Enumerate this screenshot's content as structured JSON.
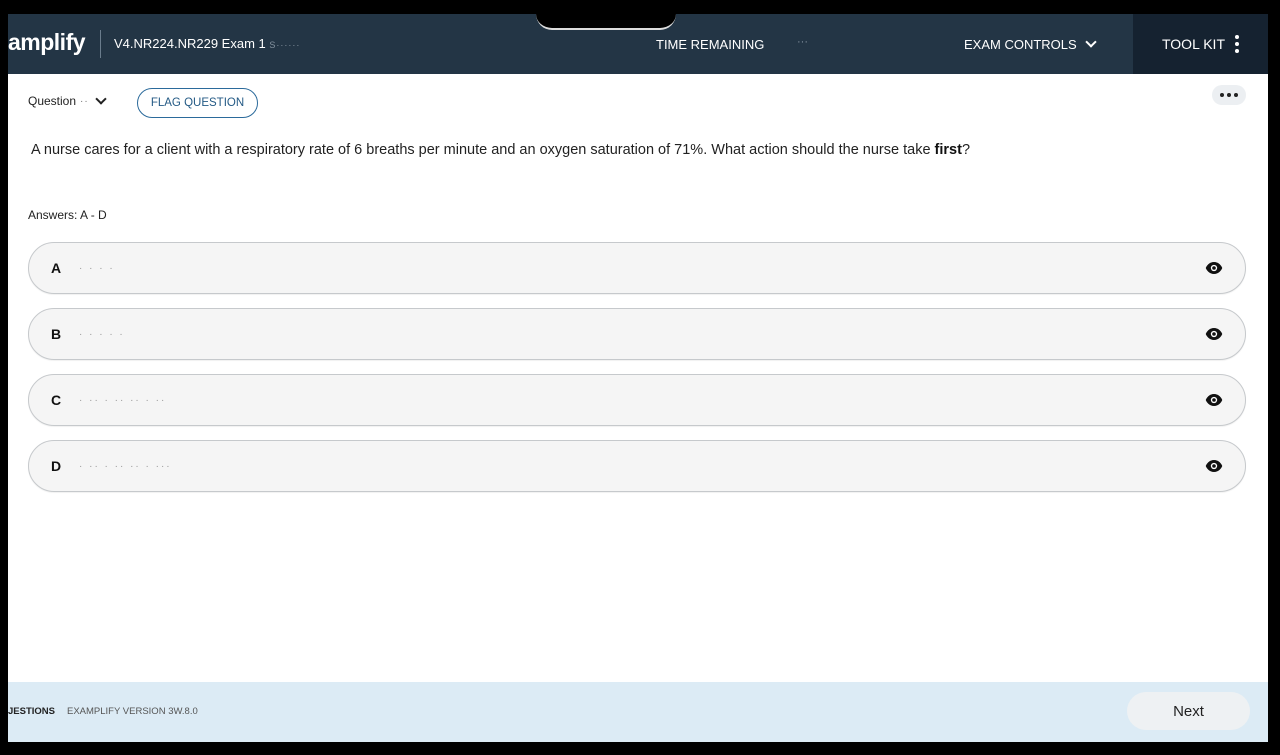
{
  "header": {
    "brand": "amplify",
    "exam_title": "V4.NR224.NR229 Exam 1",
    "exam_title_suffix": "S······",
    "time_label": "TIME REMAINING",
    "time_value": "···",
    "exam_controls_label": "EXAM CONTROLS",
    "toolkit_label": "TOOL KIT"
  },
  "question": {
    "selector_label": "Question",
    "selector_number": "··",
    "flag_label": "FLAG QUESTION",
    "stem_prefix": "A nurse cares for a client with a respiratory rate of 6 breaths per minute and an oxygen saturation of 71%. What action should the nurse take ",
    "stem_bold": "first",
    "stem_suffix": "?",
    "answers_label": "Answers: A - D"
  },
  "options": [
    {
      "letter": "A",
      "text": "·   ·   · ·"
    },
    {
      "letter": "B",
      "text": "·   · · · ·"
    },
    {
      "letter": "C",
      "text": "· ·· · ·· ·· ·  ··"
    },
    {
      "letter": "D",
      "text": "· ·· · ·· ·· · ···"
    }
  ],
  "footer": {
    "questions_label": "JESTIONS",
    "version_label": "EXAMPLIFY VERSION 3W.8.0",
    "next_label": "Next"
  },
  "colors": {
    "header_bg": "#233545",
    "toolkit_bg": "#152230",
    "flag_border": "#2b6a9b",
    "footer_bg": "#dcebf5"
  },
  "icons": {
    "option_action": "eye-icon",
    "toolkit_menu": "kebab-icon",
    "more": "more-horizontal-icon"
  }
}
